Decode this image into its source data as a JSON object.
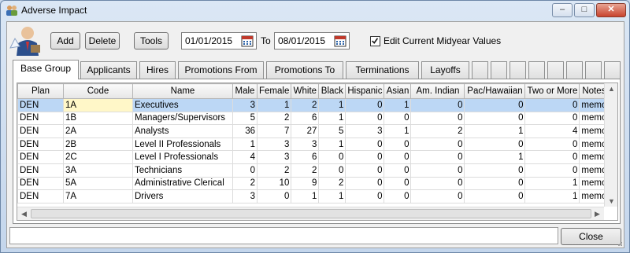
{
  "window": {
    "title": "Adverse Impact",
    "minimize": "–",
    "maximize": "□",
    "close": "✕"
  },
  "toolbar": {
    "add_label": "Add",
    "delete_label": "Delete",
    "tools_label": "Tools",
    "start_date": "01/01/2015",
    "to_label": "To",
    "end_date": "08/01/2015",
    "edit_checkbox_checked": true,
    "edit_checkbox_label": "Edit Current Midyear Values"
  },
  "tabs": [
    {
      "label": "Base Group",
      "active": true
    },
    {
      "label": "Applicants"
    },
    {
      "label": "Hires"
    },
    {
      "label": "Promotions From"
    },
    {
      "label": "Promotions To"
    },
    {
      "label": "Terminations"
    },
    {
      "label": "Layoffs"
    }
  ],
  "grid": {
    "columns": [
      "Plan",
      "Code",
      "Name",
      "Male",
      "Female",
      "White",
      "Black",
      "Hispanic",
      "Asian",
      "Am. Indian",
      "Pac/Hawaiian",
      "Two or More",
      "Notes"
    ],
    "rows": [
      [
        "DEN",
        "1A",
        "Executives",
        "3",
        "1",
        "2",
        "1",
        "0",
        "1",
        "0",
        "0",
        "0",
        "memo"
      ],
      [
        "DEN",
        "1B",
        "Managers/Supervisors",
        "5",
        "2",
        "6",
        "1",
        "0",
        "0",
        "0",
        "0",
        "0",
        "memo"
      ],
      [
        "DEN",
        "2A",
        "Analysts",
        "36",
        "7",
        "27",
        "5",
        "3",
        "1",
        "2",
        "1",
        "4",
        "memo"
      ],
      [
        "DEN",
        "2B",
        "Level II Professionals",
        "1",
        "3",
        "3",
        "1",
        "0",
        "0",
        "0",
        "0",
        "0",
        "memo"
      ],
      [
        "DEN",
        "2C",
        "Level I Professionals",
        "4",
        "3",
        "6",
        "0",
        "0",
        "0",
        "0",
        "1",
        "0",
        "memo"
      ],
      [
        "DEN",
        "3A",
        "Technicians",
        "0",
        "2",
        "2",
        "0",
        "0",
        "0",
        "0",
        "0",
        "0",
        "memo"
      ],
      [
        "DEN",
        "5A",
        "Administrative Clerical",
        "2",
        "10",
        "9",
        "2",
        "0",
        "0",
        "0",
        "0",
        "1",
        "memo"
      ],
      [
        "DEN",
        "7A",
        "Drivers",
        "3",
        "0",
        "1",
        "1",
        "0",
        "0",
        "0",
        "0",
        "1",
        "memo"
      ]
    ],
    "selected_row": 0
  },
  "footer": {
    "status_text": "",
    "close_label": "Close"
  },
  "icons": {
    "app": "user-group-icon",
    "logo": "business-person-icon",
    "calendar": "calendar-icon"
  },
  "colors": {
    "selection": "#bcd7f5",
    "edit_cell": "#fff7c8"
  }
}
